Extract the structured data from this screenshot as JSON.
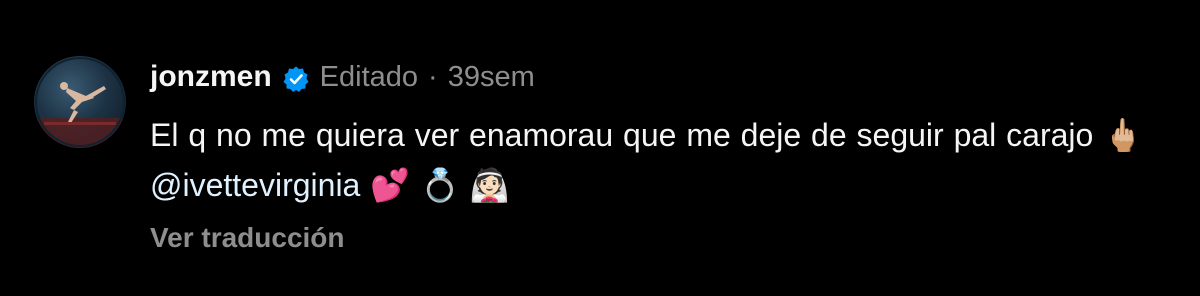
{
  "comment": {
    "username": "jonzmen",
    "edited_label": "Editado",
    "separator": "·",
    "time_ago": "39sem",
    "text_part1": "El q no me quiera ver enamorau que me deje de seguir pal carajo",
    "emoji_middle_finger": "🖕🏼",
    "mention": "@ivettevirginia",
    "emoji_hearts": "💕",
    "emoji_ring": "💍",
    "emoji_bride": "👰🏻",
    "translate_label": "Ver traducción"
  },
  "colors": {
    "background": "#000000",
    "verified_badge": "#0095f6",
    "meta_text": "#8e8e8e",
    "primary_text": "#f5f5f5"
  },
  "icons": {
    "verified": "verified-badge-icon"
  }
}
